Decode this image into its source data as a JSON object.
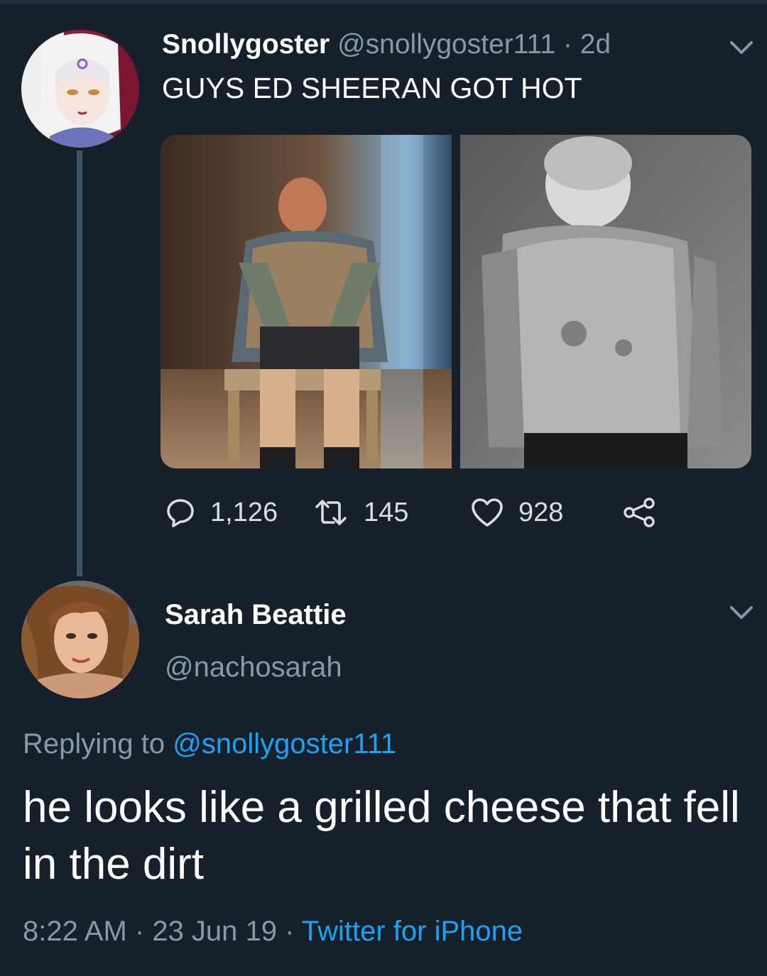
{
  "tweet": {
    "author_name": "Snollygoster",
    "author_handle": "@snollygoster111",
    "time_ago": "2d",
    "text": "GUYS ED SHEERAN GOT HOT",
    "stats": {
      "replies": "1,126",
      "retweets": "145",
      "likes": "928"
    }
  },
  "reply": {
    "author_name": "Sarah Beattie",
    "author_handle": "@nachosarah",
    "replying_prefix": "Replying to",
    "replying_to": "@snollygoster111",
    "text": "he looks like a grilled cheese that fell in the dirt",
    "time": "8:22 AM",
    "date": "23 Jun 19",
    "client": "Twitter for iPhone"
  },
  "colors": {
    "background": "#15202b",
    "secondary_text": "#8899a6",
    "link": "#1da1f2"
  },
  "icons": [
    "reply-icon",
    "retweet-icon",
    "like-icon",
    "share-icon",
    "chevron-down-icon"
  ]
}
